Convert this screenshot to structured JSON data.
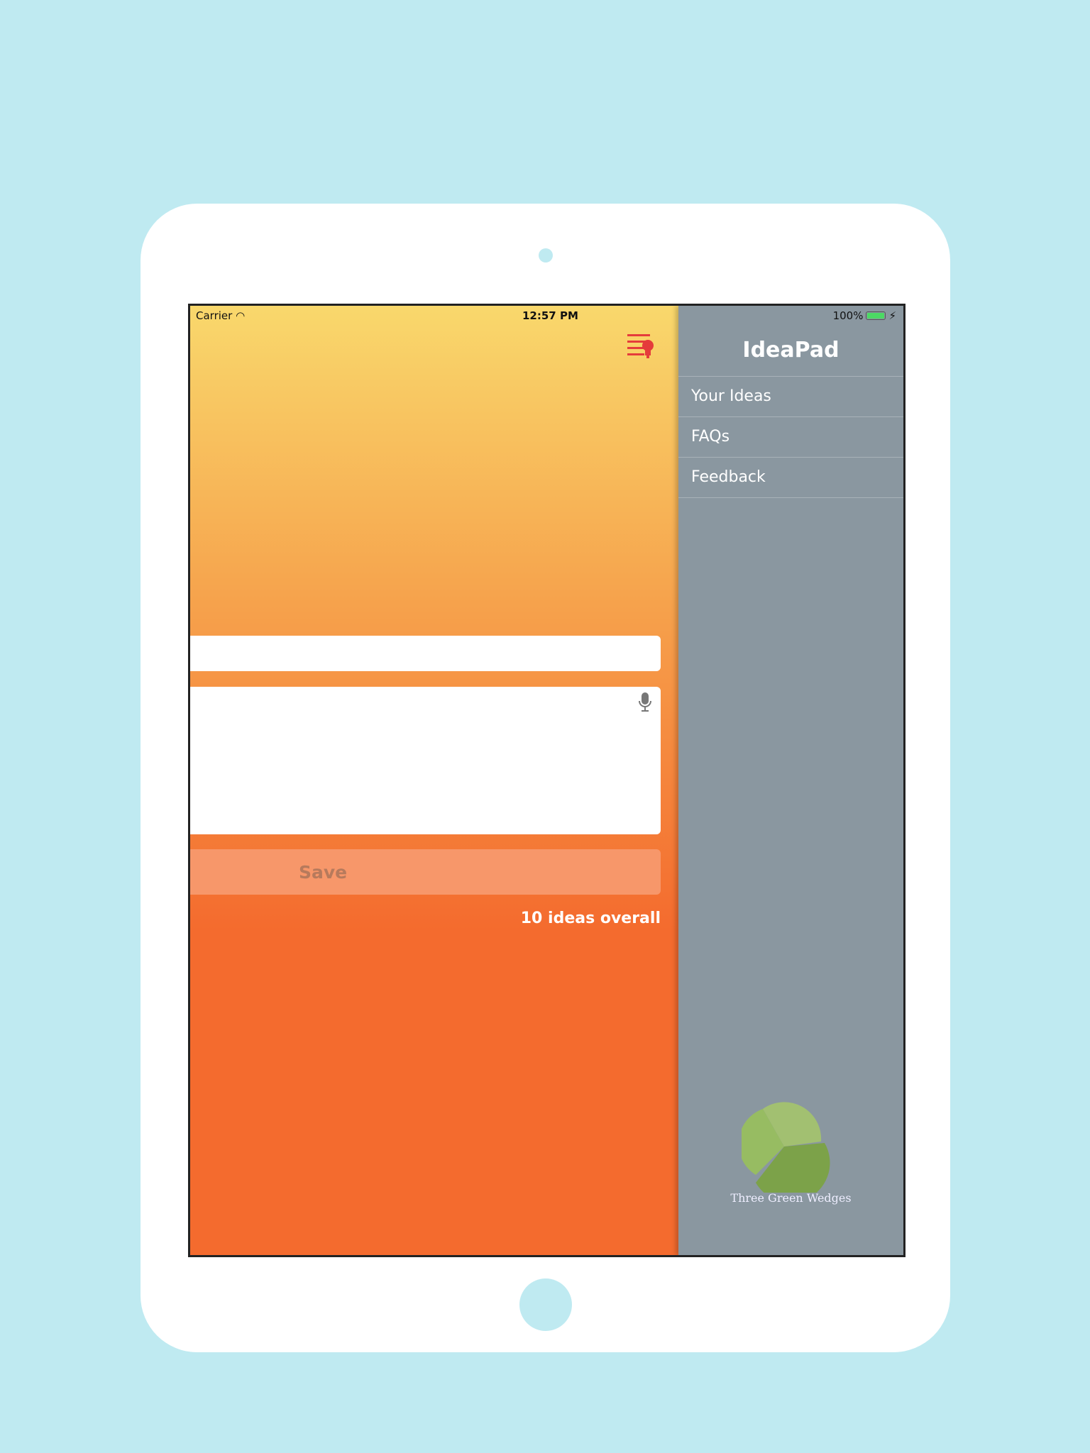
{
  "status_bar": {
    "carrier": "Carrier",
    "time": "12:57 PM",
    "battery": "100%"
  },
  "main": {
    "title_placeholder": "",
    "body_placeholder": "",
    "save_label": "Save",
    "idea_count": "10 ideas overall"
  },
  "sidebar": {
    "title": "IdeaPad",
    "items": [
      {
        "label": "Your Ideas"
      },
      {
        "label": "FAQs"
      },
      {
        "label": "Feedback"
      }
    ],
    "logo_text": "Three Green Wedges"
  },
  "colors": {
    "background": "#bfeaf1",
    "gradient_top": "#f9d86c",
    "gradient_bottom": "#f46b2e",
    "sidebar": "#8a97a0",
    "menu_icon": "#e53b3b",
    "save_button": "#f7976a"
  }
}
